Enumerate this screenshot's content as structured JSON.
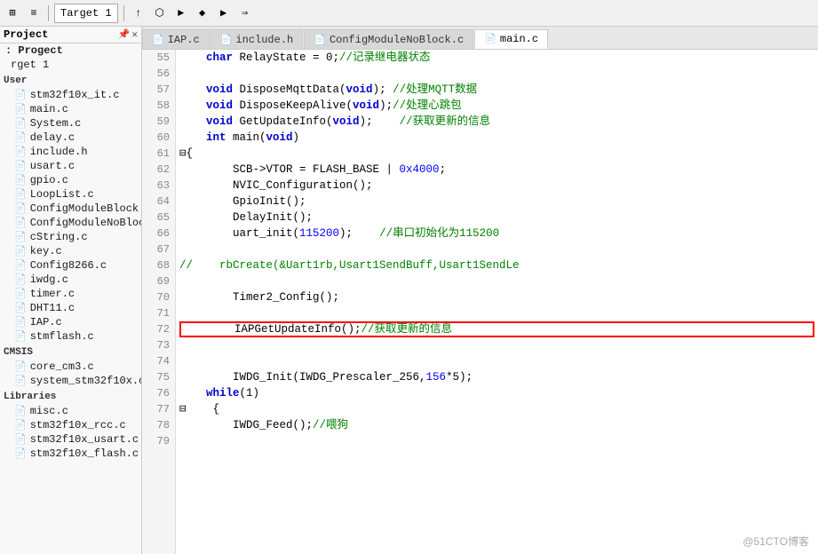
{
  "toolbar": {
    "target_label": "Target 1",
    "icons": [
      "⊞",
      "≡",
      "↑",
      "↓",
      "►",
      "◆",
      "▶",
      "⇒",
      "⬡"
    ]
  },
  "sidebar": {
    "pin_icon": "📌",
    "close_icon": "✕",
    "root_label": ": Progect",
    "target_label": "rget 1",
    "groups": [
      {
        "name": "User",
        "items": [
          "stm32f10x_it.c",
          "main.c",
          "System.c",
          "delay.c",
          "include.h",
          "usart.c",
          "gpio.c",
          "LoopList.c",
          "ConfigModuleBlock.c",
          "ConfigModuleNoBlock.c",
          "cString.c",
          "key.c",
          "Config8266.c",
          "iwdg.c",
          "timer.c",
          "DHT11.c",
          "IAP.c",
          "stmflash.c"
        ]
      },
      {
        "name": "CMSIS",
        "items": [
          "core_cm3.c",
          "system_stm32f10x.c"
        ]
      },
      {
        "name": "Libraries",
        "items": [
          "misc.c",
          "stm32f10x_rcc.c",
          "stm32f10x_usart.c",
          "stm32f10x_flash.c"
        ]
      }
    ]
  },
  "tabs": [
    {
      "label": "IAP.c",
      "active": false
    },
    {
      "label": "include.h",
      "active": false
    },
    {
      "label": "ConfigModuleNoBlock.c",
      "active": false
    },
    {
      "label": "main.c",
      "active": true
    }
  ],
  "lines": [
    {
      "num": 55,
      "text": "    char RelayState = 0;",
      "comment": "//记录继电器状态",
      "highlight": false,
      "redbox": false
    },
    {
      "num": 56,
      "text": "",
      "comment": "",
      "highlight": false,
      "redbox": false
    },
    {
      "num": 57,
      "text": "    void DisposeMqttData(void);",
      "comment": " //处理MQTT数据",
      "highlight": false,
      "redbox": false
    },
    {
      "num": 58,
      "text": "    void DisposeKeepAlive(void);",
      "comment": "//处理心跳包",
      "highlight": false,
      "redbox": false
    },
    {
      "num": 59,
      "text": "    void GetUpdateInfo(void);",
      "comment": "    //获取更新的信息",
      "highlight": false,
      "redbox": false
    },
    {
      "num": 60,
      "text": "    int main(void)",
      "comment": "",
      "highlight": false,
      "redbox": false
    },
    {
      "num": 61,
      "text": "⊟{",
      "comment": "",
      "highlight": false,
      "redbox": false
    },
    {
      "num": 62,
      "text": "    SCB->VTOR = FLASH_BASE | 0x4000;",
      "comment": "",
      "highlight": false,
      "redbox": false
    },
    {
      "num": 63,
      "text": "    NVIC_Configuration();",
      "comment": "",
      "highlight": false,
      "redbox": false
    },
    {
      "num": 64,
      "text": "    GpioInit();",
      "comment": "",
      "highlight": false,
      "redbox": false
    },
    {
      "num": 65,
      "text": "    DelayInit();",
      "comment": "",
      "highlight": false,
      "redbox": false
    },
    {
      "num": 66,
      "text": "    uart_init(115200);",
      "comment": "    //串口初始化为115200",
      "highlight": false,
      "redbox": false
    },
    {
      "num": 67,
      "text": "",
      "comment": "",
      "highlight": false,
      "redbox": false
    },
    {
      "num": 68,
      "text": "//    rbCreate(&Uart1rb,Usart1SendBuff,Usart1SendLe",
      "comment": "",
      "highlight": false,
      "redbox": false
    },
    {
      "num": 69,
      "text": "",
      "comment": "",
      "highlight": false,
      "redbox": false
    },
    {
      "num": 70,
      "text": "    Timer2_Config();",
      "comment": "",
      "highlight": false,
      "redbox": false
    },
    {
      "num": 71,
      "text": "",
      "comment": "",
      "highlight": false,
      "redbox": false
    },
    {
      "num": 72,
      "text": "    IAPGetUpdateInfo();",
      "comment": "//获取更新的信息",
      "highlight": false,
      "redbox": true
    },
    {
      "num": 73,
      "text": "",
      "comment": "",
      "highlight": false,
      "redbox": false
    },
    {
      "num": 74,
      "text": "",
      "comment": "",
      "highlight": false,
      "redbox": false
    },
    {
      "num": 75,
      "text": "    IWDG_Init(IWDG_Prescaler_256,156*5);",
      "comment": "",
      "highlight": false,
      "redbox": false
    },
    {
      "num": 76,
      "text": "    while(1)",
      "comment": "",
      "highlight": false,
      "redbox": false
    },
    {
      "num": 77,
      "text": "⊟    {",
      "comment": "",
      "highlight": false,
      "redbox": false
    },
    {
      "num": 78,
      "text": "        IWDG_Feed();",
      "comment": "//喂狗",
      "highlight": false,
      "redbox": false
    },
    {
      "num": 79,
      "text": "",
      "comment": "",
      "highlight": false,
      "redbox": false
    }
  ],
  "watermark": "@51CTO博客"
}
